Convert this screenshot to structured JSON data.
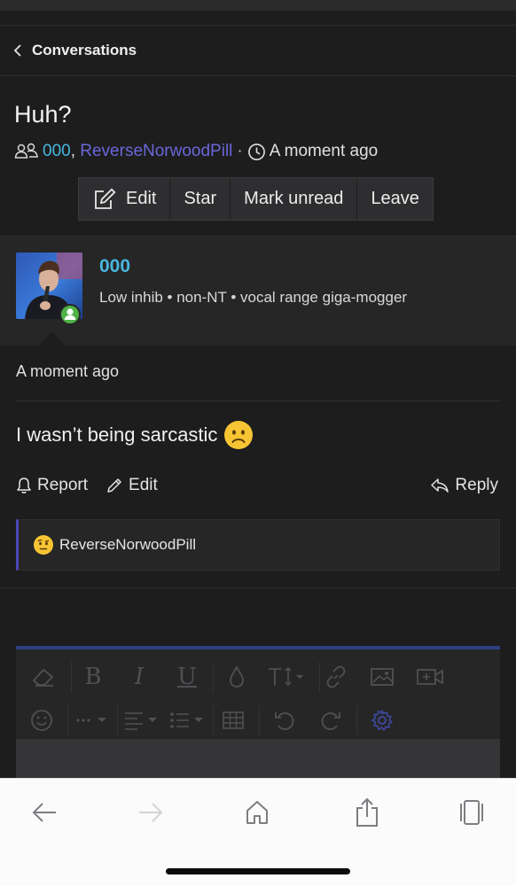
{
  "nav": {
    "back_label": "Conversations"
  },
  "conversation": {
    "title": "Huh?",
    "participants": [
      "000",
      "ReverseNorwoodPill"
    ],
    "participant_separator": ",",
    "meta_separator": "·",
    "time": "A moment ago"
  },
  "toolbar": {
    "edit": "Edit",
    "star": "Star",
    "mark_unread": "Mark unread",
    "leave": "Leave"
  },
  "message": {
    "author": "000",
    "author_title": "Low inhib • non-NT • vocal range giga-mogger",
    "time": "A moment ago",
    "text": "I wasn’t being sarcastic",
    "report": "Report",
    "edit": "Edit",
    "reply": "Reply",
    "reaction_user": "ReverseNorwoodPill"
  },
  "colors": {
    "background": "#1d1d1e",
    "link_blue": "#47b6de",
    "link_purple": "#6a66d9",
    "online_green": "#4fb346",
    "reaction_border": "#4b47b8",
    "editor_top": "#2e3f82"
  },
  "icons": {
    "participants": "users-icon",
    "time": "clock-icon",
    "edit": "pencil-square-icon",
    "report": "bell-icon",
    "reply": "reply-arrow-icon",
    "reaction": "raised-eyebrow-emoji",
    "message_emoji": "slightly-frowning-emoji"
  }
}
